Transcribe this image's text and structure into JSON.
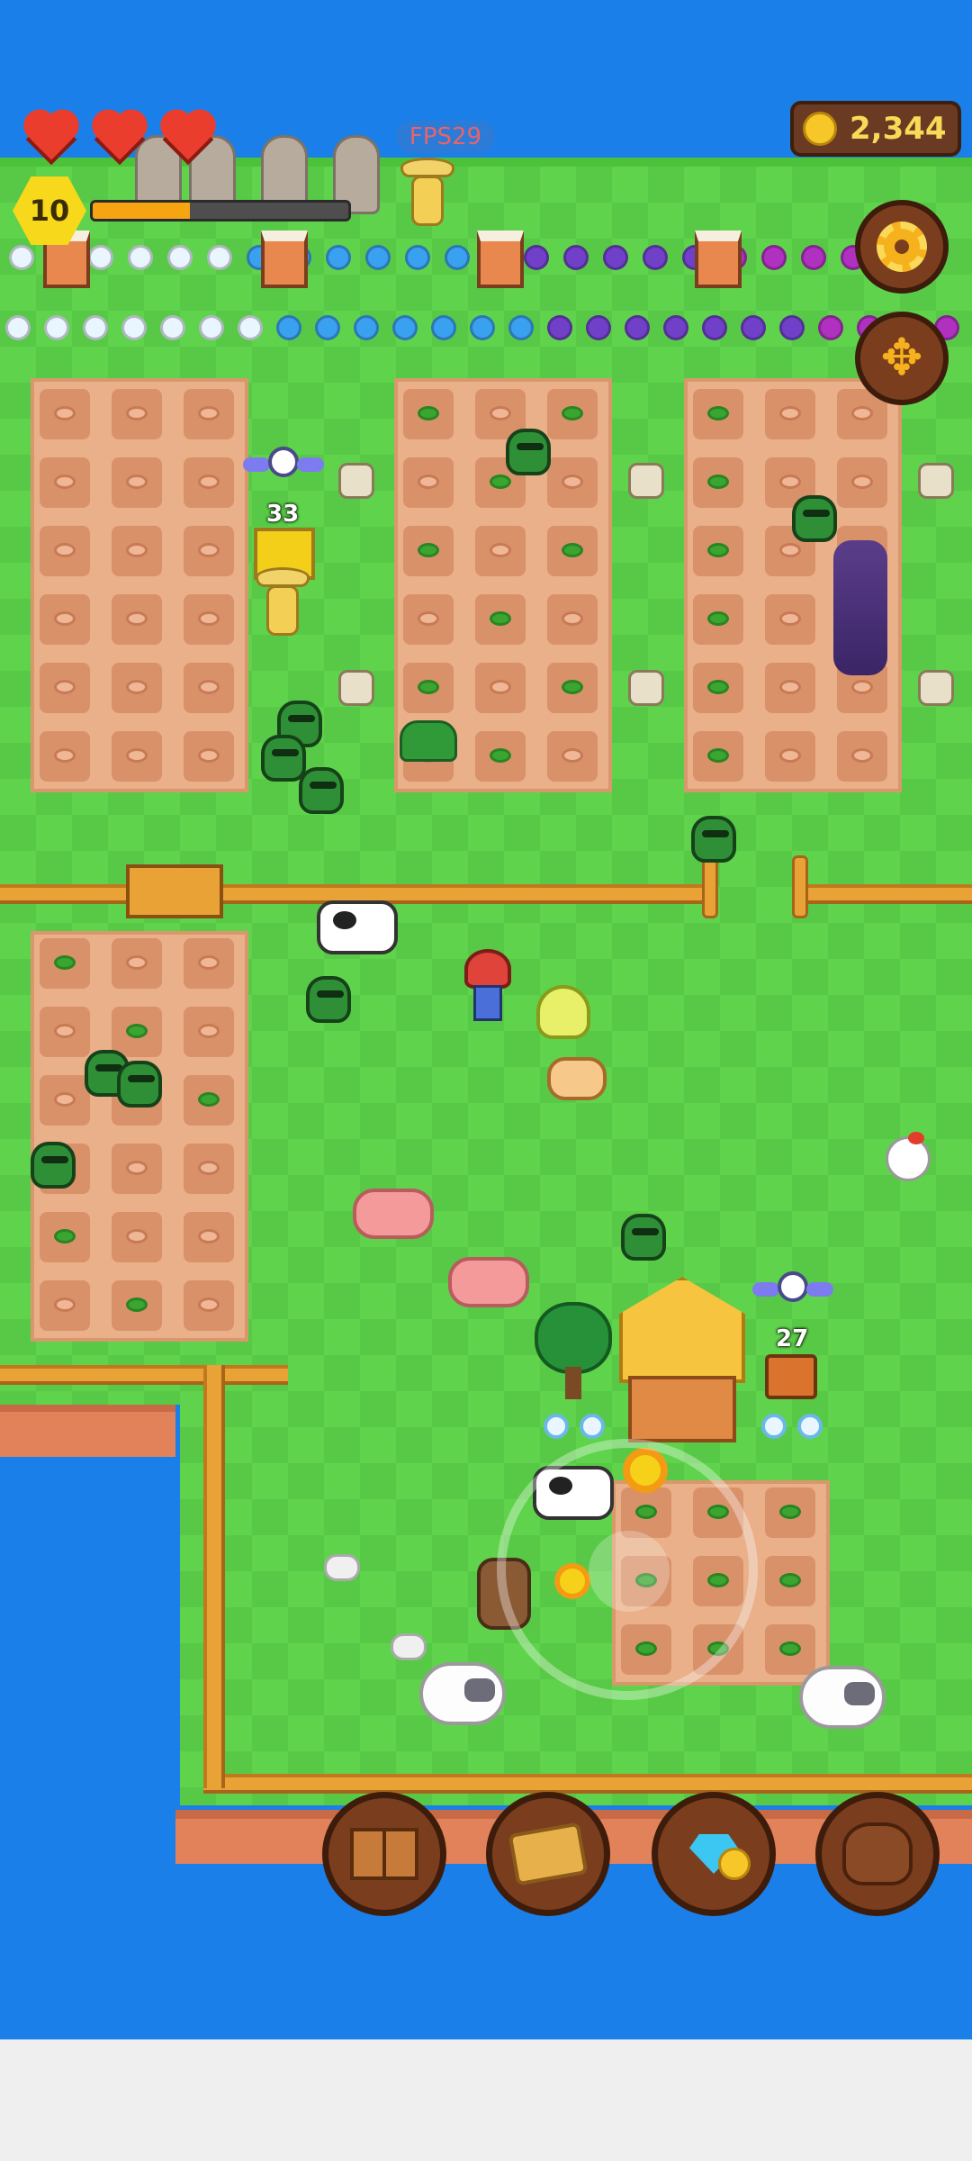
{
  "hud": {
    "level": "10",
    "hearts": 3,
    "xp_progress": 0.38,
    "fps_label": "FPS29",
    "coins": "2,344"
  },
  "buttons": {
    "settings_icon": "gear-icon",
    "move_icon": "move-arrows-icon",
    "bottom": [
      {
        "name": "journal-button",
        "icon": "book-icon"
      },
      {
        "name": "map-button",
        "icon": "map-icon"
      },
      {
        "name": "shop-button",
        "icon": "gem-coin-icon"
      },
      {
        "name": "inventory-button",
        "icon": "bag-icon"
      }
    ]
  },
  "world": {
    "drone_count_a": "33",
    "drone_count_b": "27"
  },
  "colors": {
    "water": "#1a7fe8",
    "grass": "#5fd34c",
    "dirt": "#e9b08a",
    "ui_brown": "#7a3e1f",
    "coin_text": "#f9d957"
  }
}
